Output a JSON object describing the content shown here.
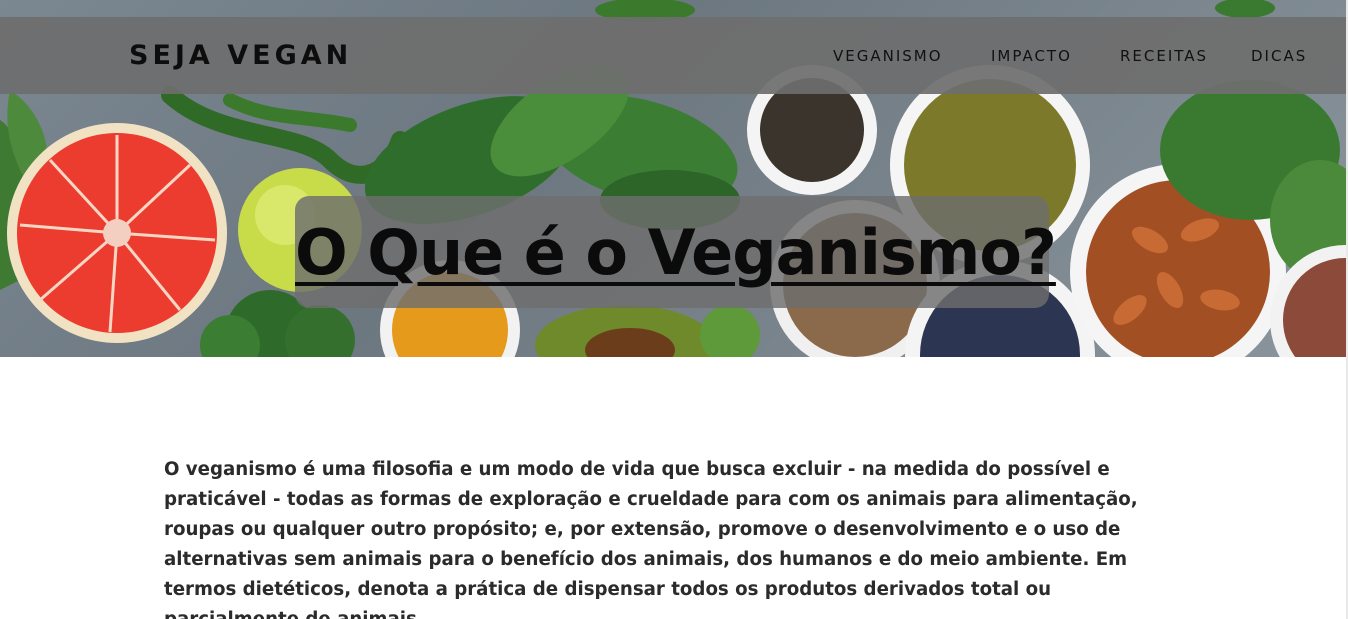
{
  "brand": {
    "name": "SEJA VEGAN"
  },
  "nav": {
    "items": [
      {
        "label": "VEGANISMO"
      },
      {
        "label": "IMPACTO"
      },
      {
        "label": "RECEITAS"
      },
      {
        "label": "DICAS"
      }
    ]
  },
  "hero": {
    "title": "O Que é o Veganismo?"
  },
  "main": {
    "paragraph": "O veganismo é uma filosofia e um modo de vida que busca excluir - na medida do possível e praticável - todas as formas de exploração e crueldade para com os animais para alimentação, roupas ou qualquer outro propósito; e, por extensão, promove o desenvolvimento e o uso de alternativas sem animais para o benefício dos animais, dos humanos e do meio ambiente. Em termos dietéticos, denota a prática de dispensar todos os produtos derivados total ou parcialmente de animais."
  },
  "colors": {
    "navbar_bg": "#6e6e6e",
    "text_dark": "#111111",
    "body_text": "#2b2b2b"
  }
}
